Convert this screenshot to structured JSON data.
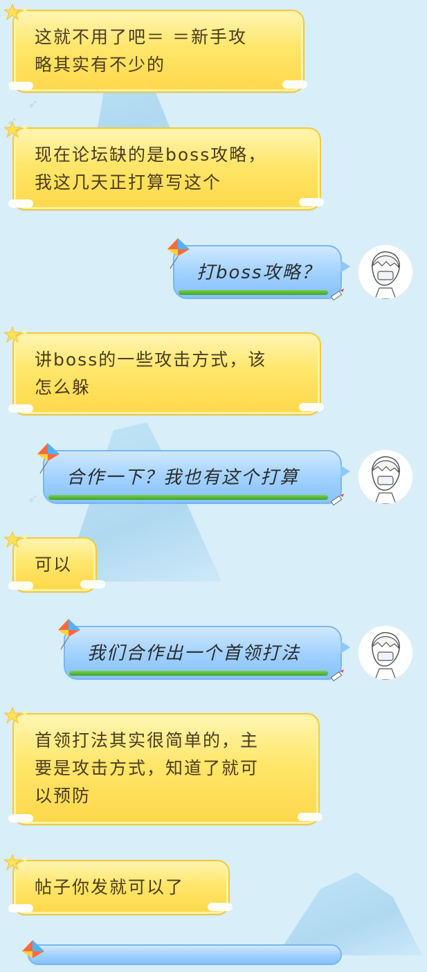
{
  "colors": {
    "background": "#d8eef9",
    "incoming_bubble": "#ffe66a",
    "outgoing_bubble": "#9fd0ff",
    "incoming_text": "#4a3b1f",
    "outgoing_text": "#2b2b2b"
  },
  "messages": [
    {
      "side": "in",
      "text_lines": [
        "这就不用了吧＝ ＝新手攻",
        "略其实有不少的"
      ]
    },
    {
      "side": "in",
      "text_lines": [
        "现在论坛缺的是boss攻略，",
        "我这几天正打算写这个"
      ]
    },
    {
      "side": "out",
      "text_lines": [
        "打boss攻略？"
      ],
      "avatar": "avatar-icon"
    },
    {
      "side": "in",
      "text_lines": [
        "讲boss的一些攻击方式，该",
        "怎么躲"
      ]
    },
    {
      "side": "out",
      "text_lines": [
        "合作一下？我也有这个打算"
      ],
      "avatar": "avatar-icon"
    },
    {
      "side": "in",
      "text_lines": [
        "可以"
      ]
    },
    {
      "side": "out",
      "text_lines": [
        "我们合作出一个首领打法"
      ],
      "avatar": "avatar-icon"
    },
    {
      "side": "in",
      "text_lines": [
        "首领打法其实很简单的，主",
        "要是攻击方式，知道了就可",
        "以预防"
      ]
    },
    {
      "side": "in",
      "text_lines": [
        "帖子你发就可以了"
      ]
    }
  ]
}
